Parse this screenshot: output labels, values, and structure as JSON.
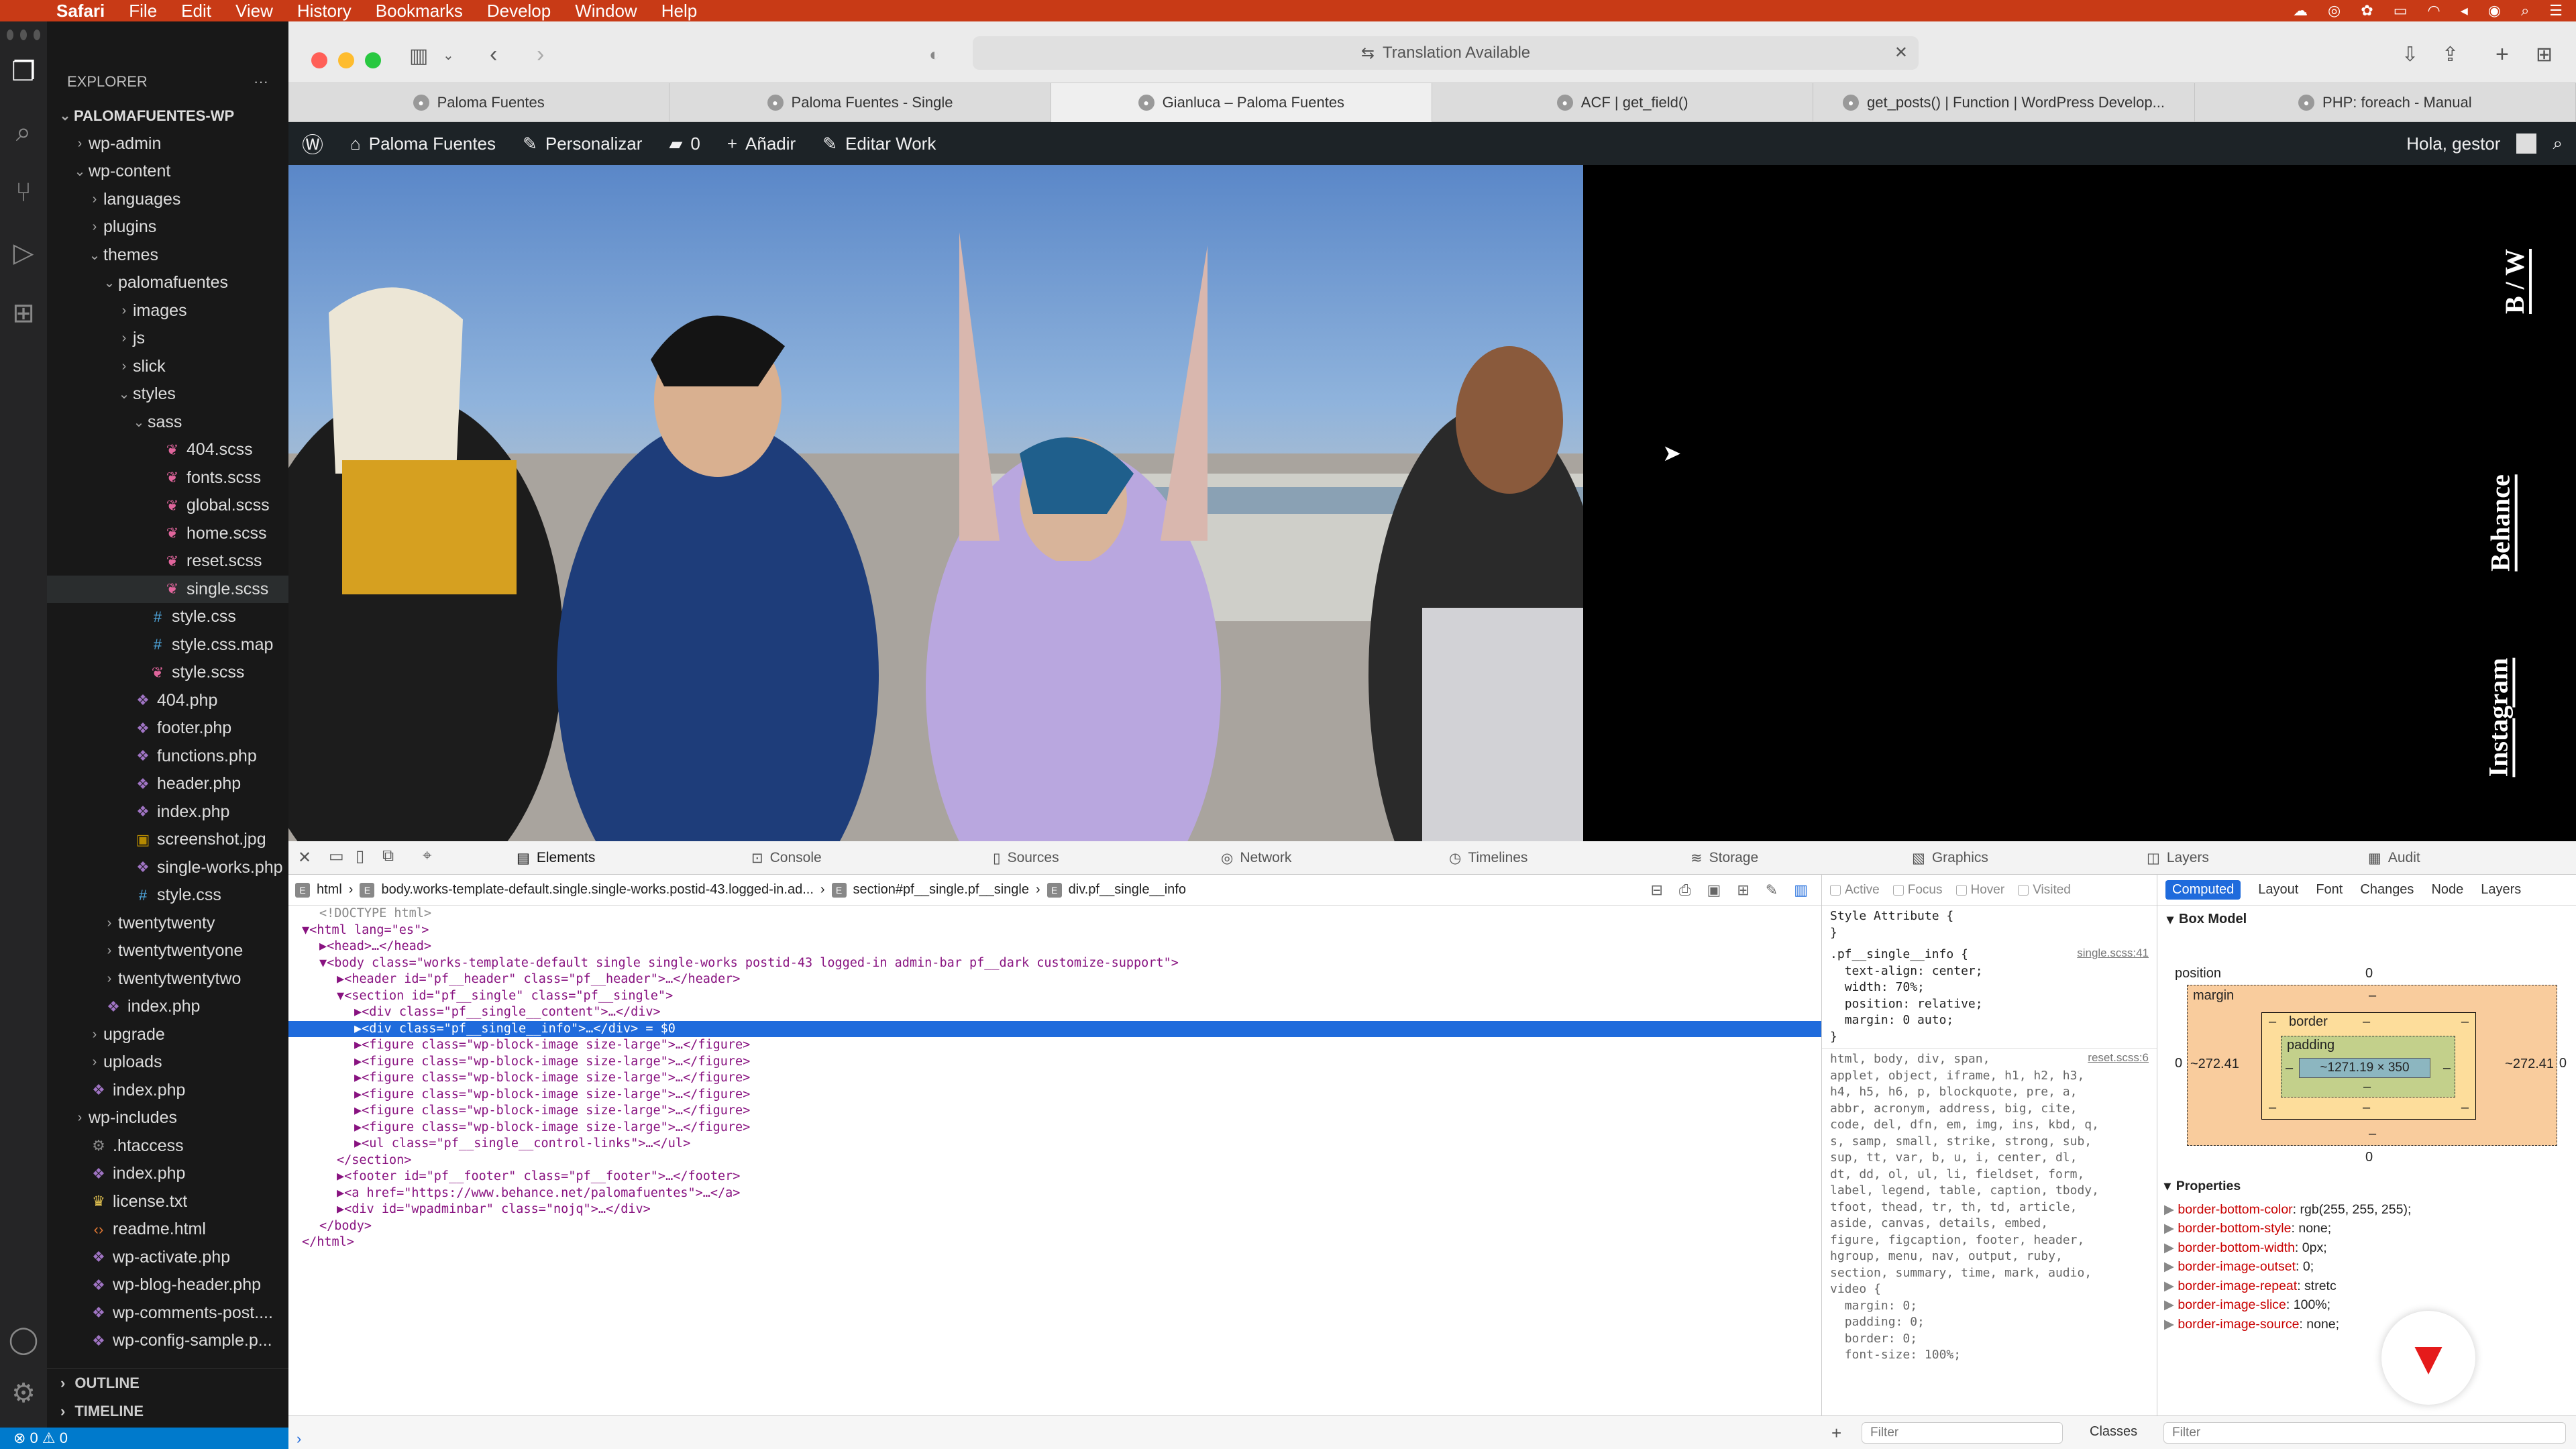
{
  "menubar": {
    "app": "Safari",
    "items": [
      "File",
      "Edit",
      "View",
      "History",
      "Bookmarks",
      "Develop",
      "Window",
      "Help"
    ],
    "accent": "#c83a16"
  },
  "vscode": {
    "explorer_title": "EXPLORER",
    "more": "···",
    "root": "PALOMAFUENTES-WP",
    "tree": [
      {
        "label": "wp-admin",
        "indent": 1,
        "kind": "folder",
        "open": false
      },
      {
        "label": "wp-content",
        "indent": 1,
        "kind": "folder",
        "open": true
      },
      {
        "label": "languages",
        "indent": 2,
        "kind": "folder",
        "open": false
      },
      {
        "label": "plugins",
        "indent": 2,
        "kind": "folder",
        "open": false
      },
      {
        "label": "themes",
        "indent": 2,
        "kind": "folder",
        "open": true
      },
      {
        "label": "palomafuentes",
        "indent": 3,
        "kind": "folder",
        "open": true
      },
      {
        "label": "images",
        "indent": 4,
        "kind": "folder",
        "open": false
      },
      {
        "label": "js",
        "indent": 4,
        "kind": "folder",
        "open": false
      },
      {
        "label": "slick",
        "indent": 4,
        "kind": "folder",
        "open": false
      },
      {
        "label": "styles",
        "indent": 4,
        "kind": "folder",
        "open": true
      },
      {
        "label": "sass",
        "indent": 5,
        "kind": "folder",
        "open": true
      },
      {
        "label": "404.scss",
        "indent": 6,
        "kind": "scss"
      },
      {
        "label": "fonts.scss",
        "indent": 6,
        "kind": "scss"
      },
      {
        "label": "global.scss",
        "indent": 6,
        "kind": "scss"
      },
      {
        "label": "home.scss",
        "indent": 6,
        "kind": "scss"
      },
      {
        "label": "reset.scss",
        "indent": 6,
        "kind": "scss"
      },
      {
        "label": "single.scss",
        "indent": 6,
        "kind": "scss",
        "selected": true
      },
      {
        "label": "style.css",
        "indent": 5,
        "kind": "css"
      },
      {
        "label": "style.css.map",
        "indent": 5,
        "kind": "css"
      },
      {
        "label": "style.scss",
        "indent": 5,
        "kind": "scss"
      },
      {
        "label": "404.php",
        "indent": 4,
        "kind": "php"
      },
      {
        "label": "footer.php",
        "indent": 4,
        "kind": "php"
      },
      {
        "label": "functions.php",
        "indent": 4,
        "kind": "php"
      },
      {
        "label": "header.php",
        "indent": 4,
        "kind": "php"
      },
      {
        "label": "index.php",
        "indent": 4,
        "kind": "php"
      },
      {
        "label": "screenshot.jpg",
        "indent": 4,
        "kind": "img"
      },
      {
        "label": "single-works.php",
        "indent": 4,
        "kind": "php"
      },
      {
        "label": "style.css",
        "indent": 4,
        "kind": "css"
      },
      {
        "label": "twentytwenty",
        "indent": 3,
        "kind": "folder",
        "open": false
      },
      {
        "label": "twentytwentyone",
        "indent": 3,
        "kind": "folder",
        "open": false
      },
      {
        "label": "twentytwentytwo",
        "indent": 3,
        "kind": "folder",
        "open": false
      },
      {
        "label": "index.php",
        "indent": 2,
        "kind": "php"
      },
      {
        "label": "upgrade",
        "indent": 2,
        "kind": "folder",
        "open": false
      },
      {
        "label": "uploads",
        "indent": 2,
        "kind": "folder",
        "open": false
      },
      {
        "label": "index.php",
        "indent": 1,
        "kind": "php"
      },
      {
        "label": "wp-includes",
        "indent": 1,
        "kind": "folder",
        "open": false
      },
      {
        "label": ".htaccess",
        "indent": 1,
        "kind": "gear"
      },
      {
        "label": "index.php",
        "indent": 1,
        "kind": "php"
      },
      {
        "label": "license.txt",
        "indent": 1,
        "kind": "txt"
      },
      {
        "label": "readme.html",
        "indent": 1,
        "kind": "html"
      },
      {
        "label": "wp-activate.php",
        "indent": 1,
        "kind": "php"
      },
      {
        "label": "wp-blog-header.php",
        "indent": 1,
        "kind": "php"
      },
      {
        "label": "wp-comments-post....",
        "indent": 1,
        "kind": "php"
      },
      {
        "label": "wp-config-sample.p...",
        "indent": 1,
        "kind": "php"
      }
    ],
    "outline": "OUTLINE",
    "timeline": "TIMELINE",
    "status": "⊗ 0 ⚠ 0"
  },
  "safari": {
    "address": "Translation Available",
    "tabs": [
      {
        "label": "Paloma Fuentes",
        "active": false
      },
      {
        "label": "Paloma Fuentes - Single",
        "active": false
      },
      {
        "label": "Gianluca – Paloma Fuentes",
        "active": true
      },
      {
        "label": "ACF | get_field()",
        "active": false
      },
      {
        "label": "get_posts() | Function | WordPress Develop...",
        "active": false
      },
      {
        "label": "PHP: foreach - Manual",
        "active": false
      }
    ]
  },
  "wpbar": {
    "site": "Paloma Fuentes",
    "customize": "Personalizar",
    "comments": "0",
    "add": "Añadir",
    "edit": "Editar Work",
    "greeting": "Hola, gestor"
  },
  "page": {
    "side_links": [
      "B / W",
      "Behance",
      "Instagram"
    ]
  },
  "devtools": {
    "tabs": [
      "Elements",
      "Console",
      "Sources",
      "Network",
      "Timelines",
      "Storage",
      "Graphics",
      "Layers",
      "Audit"
    ],
    "active_tab": "Elements",
    "breadcrumbs": [
      "html",
      "body.works-template-default.single.single-works.postid-43.logged-in.ad...",
      "section#pf__single.pf__single",
      "div.pf__single__info"
    ],
    "dom": [
      {
        "t": "<!DOCTYPE html>",
        "c": "cm",
        "i": 1
      },
      {
        "t": "▼<html lang=\"es\">",
        "i": 0
      },
      {
        "t": "▶<head>…</head>",
        "i": 1
      },
      {
        "t": "▼<body class=\"works-template-default single single-works postid-43 logged-in admin-bar pf__dark customize-support\">",
        "i": 1
      },
      {
        "t": "▶<header id=\"pf__header\" class=\"pf__header\">…</header>",
        "i": 2
      },
      {
        "t": "▼<section id=\"pf__single\" class=\"pf__single\">",
        "i": 2
      },
      {
        "t": "▶<div class=\"pf__single__content\">…</div>",
        "i": 3
      },
      {
        "t": "▶<div class=\"pf__single__info\">…</div> = $0",
        "i": 3,
        "hl": true
      },
      {
        "t": "▶<figure class=\"wp-block-image size-large\">…</figure>",
        "i": 3
      },
      {
        "t": "▶<figure class=\"wp-block-image size-large\">…</figure>",
        "i": 3
      },
      {
        "t": "▶<figure class=\"wp-block-image size-large\">…</figure>",
        "i": 3
      },
      {
        "t": "▶<figure class=\"wp-block-image size-large\">…</figure>",
        "i": 3
      },
      {
        "t": "▶<figure class=\"wp-block-image size-large\">…</figure>",
        "i": 3
      },
      {
        "t": "▶<figure class=\"wp-block-image size-large\">…</figure>",
        "i": 3
      },
      {
        "t": "▶<ul class=\"pf__single__control-links\">…</ul>",
        "i": 3
      },
      {
        "t": "</section>",
        "i": 2
      },
      {
        "t": "▶<footer id=\"pf__footer\" class=\"pf__footer\">…</footer>",
        "i": 2
      },
      {
        "t": "▶<a href=\"https://www.behance.net/palomafuentes\">…</a>",
        "i": 2
      },
      {
        "t": "▶<div id=\"wpadminbar\" class=\"nojq\">…</div>",
        "i": 2
      },
      {
        "t": "</body>",
        "i": 1
      },
      {
        "t": "</html>",
        "i": 0
      }
    ],
    "style_filters": [
      "Active",
      "Focus",
      "Hover",
      "Visited"
    ],
    "style_attr": "Style Attribute {\n}",
    "rule1_src": "single.scss:41",
    "rule1": ".pf__single__info {\n  text-align: center;\n  width: 70%;\n  position: relative;\n  margin: 0 auto;\n}",
    "rule2_src": "reset.scss:6",
    "rule2": "html, body, div, span,\napplet, object, iframe, h1, h2, h3,\nh4, h5, h6, p, blockquote, pre, a,\nabbr, acronym, address, big, cite,\ncode, del, dfn, em, img, ins, kbd, q,\ns, samp, small, strike, strong, sub,\nsup, tt, var, b, u, i, center, dl,\ndt, dd, ol, ul, li, fieldset, form,\nlabel, legend, table, caption, tbody,\ntfoot, thead, tr, th, td, article,\naside, canvas, details, embed,\nfigure, figcaption, footer, header,\nhgroup, menu, nav, output, ruby,\nsection, summary, time, mark, audio,\nvideo {\n  margin: 0;\n  padding: 0;\n  border: 0;\n  font-size: 100%;",
    "computed_tabs": [
      "Computed",
      "Layout",
      "Font",
      "Changes",
      "Node",
      "Layers"
    ],
    "box_model_title": "Box Model",
    "box": {
      "position": "position",
      "pos_val": "0",
      "margin": "margin",
      "border": "border",
      "padding": "padding",
      "content": "~1271.19 × 350",
      "left": "~272.41",
      "right": "~272.41",
      "dash": "–",
      "zero": "0"
    },
    "properties_title": "Properties",
    "properties": [
      {
        "k": "border-bottom-color",
        "v": "rgb(255, 255, 255);"
      },
      {
        "k": "border-bottom-style",
        "v": "none;"
      },
      {
        "k": "border-bottom-width",
        "v": "0px;"
      },
      {
        "k": "border-image-outset",
        "v": "0;"
      },
      {
        "k": "border-image-repeat",
        "v": "stretc"
      },
      {
        "k": "border-image-slice",
        "v": "100%;"
      },
      {
        "k": "border-image-source",
        "v": "none;"
      }
    ],
    "filter_placeholder": "Filter",
    "classes": "Classes"
  }
}
